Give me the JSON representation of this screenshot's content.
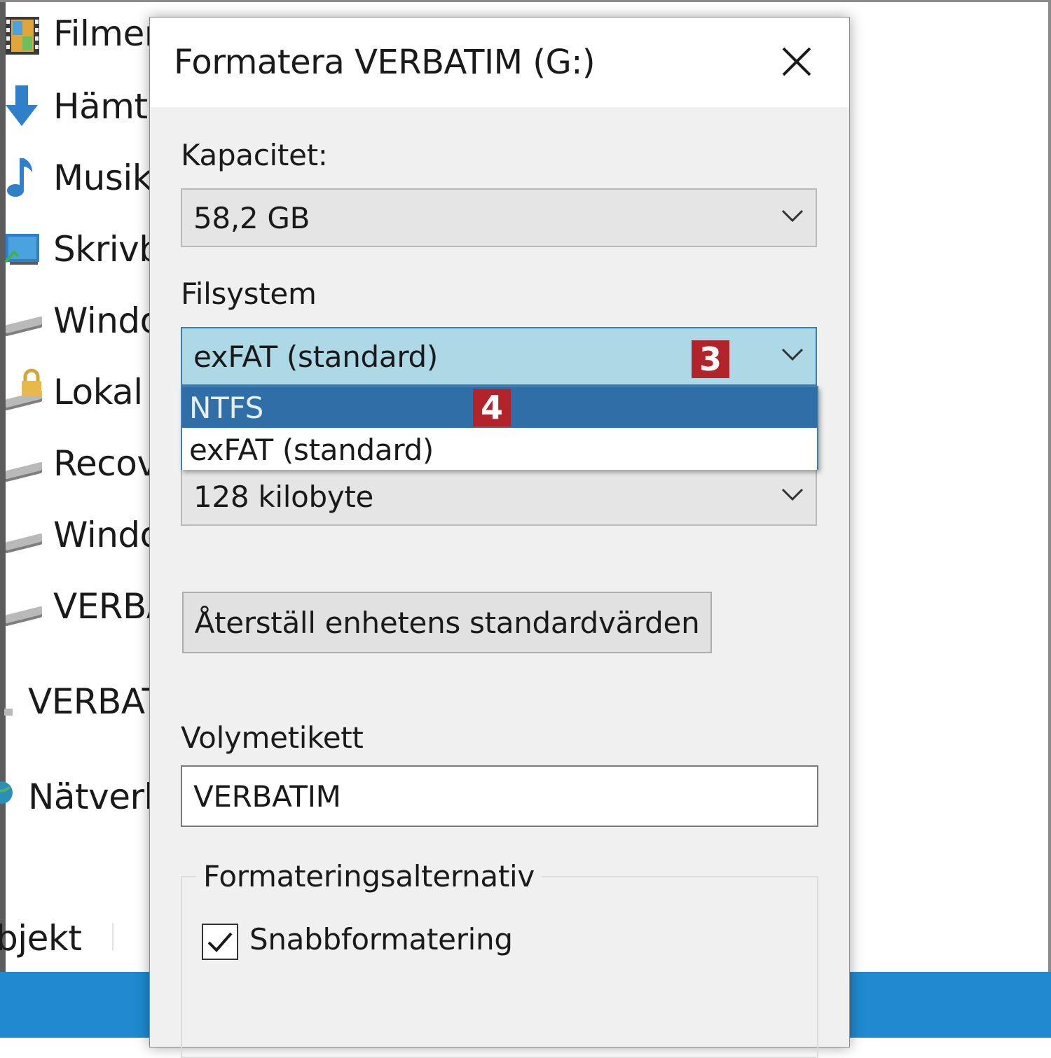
{
  "explorer": {
    "nav_items": [
      {
        "label": "Filmer",
        "icon": "film-icon"
      },
      {
        "label": "Hämta",
        "icon": "download-arrow-icon"
      },
      {
        "label": "Musik",
        "icon": "music-note-icon"
      },
      {
        "label": "Skrivb",
        "icon": "desktop-icon"
      },
      {
        "label": "Windo",
        "icon": "drive-icon"
      },
      {
        "label": "Lokal",
        "icon": "locked-drive-icon"
      },
      {
        "label": "Recov",
        "icon": "drive-icon"
      },
      {
        "label": "Windo",
        "icon": "drive-icon"
      },
      {
        "label": "VERBA",
        "icon": "usb-drive-icon"
      },
      {
        "label": "VERBAT",
        "icon": "usb-drive-icon"
      },
      {
        "label": "Nätverk",
        "icon": "network-globe-icon"
      }
    ],
    "status_text": "bjekt"
  },
  "dialog": {
    "title": "Formatera VERBATIM (G:)",
    "capacity": {
      "label": "Kapacitet:",
      "value": "58,2 GB"
    },
    "filesystem": {
      "label": "Filsystem",
      "value": "exFAT (standard)",
      "badge": "3",
      "options": [
        "NTFS",
        "exFAT (standard)"
      ],
      "highlighted_option": "NTFS",
      "option_badge": "4"
    },
    "allocation": {
      "value": "128 kilobyte"
    },
    "restore_button": "Återställ enhetens standardvärden",
    "volume_label": {
      "label": "Volymetikett",
      "value": "VERBATIM"
    },
    "format_options": {
      "legend": "Formateringsalternativ",
      "quick_format_label": "Snabbformatering",
      "quick_format_checked": true
    }
  },
  "colors": {
    "taskbar": "#1f8ad0",
    "dropdown_highlight": "#2f6ea6",
    "combo_focus": "#add8e6",
    "badge": "#b3232a"
  }
}
